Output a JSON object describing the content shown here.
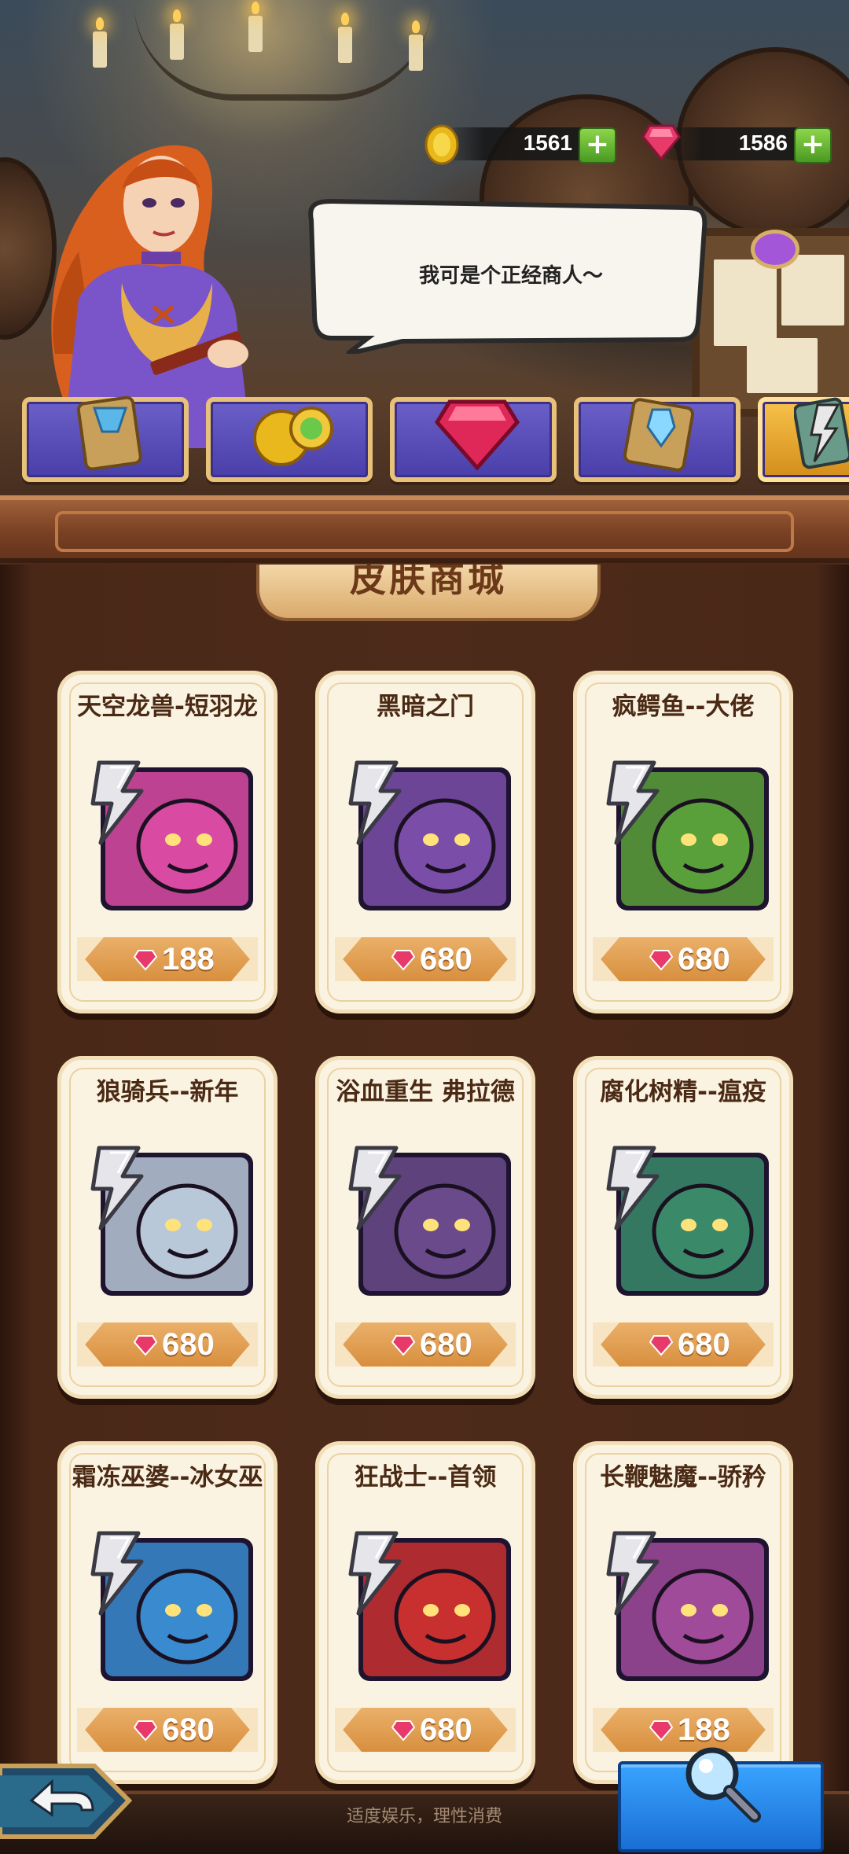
{
  "currency": {
    "gold": "1561",
    "gems": "1586",
    "gold_icon": "gold-coin-icon",
    "gem_icon": "red-gem-icon",
    "add_icon": "plus-icon"
  },
  "merchant": {
    "speech": "我可是个正经商人～"
  },
  "tabs": [
    {
      "icon": "scroll-card-icon",
      "active": false
    },
    {
      "icon": "coins-icon",
      "active": false
    },
    {
      "icon": "big-gem-icon",
      "active": false
    },
    {
      "icon": "blue-crystal-scroll-icon",
      "active": false
    },
    {
      "icon": "skin-card-icon",
      "active": true
    }
  ],
  "shop": {
    "title": "皮肤商城",
    "items": [
      {
        "name": "天空龙兽-短羽龙",
        "price": "188",
        "color": "#d94aa2"
      },
      {
        "name": "黑暗之门",
        "price": "680",
        "color": "#7a4ea8"
      },
      {
        "name": "疯鳄鱼--大佬",
        "price": "680",
        "color": "#5aa03a"
      },
      {
        "name": "狼骑兵--新年",
        "price": "680",
        "color": "#b8c8d8"
      },
      {
        "name": "浴血重生 弗拉德",
        "price": "680",
        "color": "#6a4a8a"
      },
      {
        "name": "腐化树精--瘟疫",
        "price": "680",
        "color": "#3a8a6a"
      },
      {
        "name": "霜冻巫婆--冰女巫",
        "price": "680",
        "color": "#3a8ad0"
      },
      {
        "name": "狂战士--首领",
        "price": "680",
        "color": "#c83030"
      },
      {
        "name": "长鞭魅魔--骄矜",
        "price": "188",
        "color": "#a04a9a"
      }
    ]
  },
  "footer": {
    "text": "适度娱乐，理性消费",
    "back_icon": "back-arrow-icon",
    "search_icon": "magnifier-icon"
  },
  "colors": {
    "card_bg": "#fbf3e2",
    "price_bg": "#d88f3e",
    "tab_purple": "#5a4fb8",
    "tab_active": "#f0b03a"
  }
}
